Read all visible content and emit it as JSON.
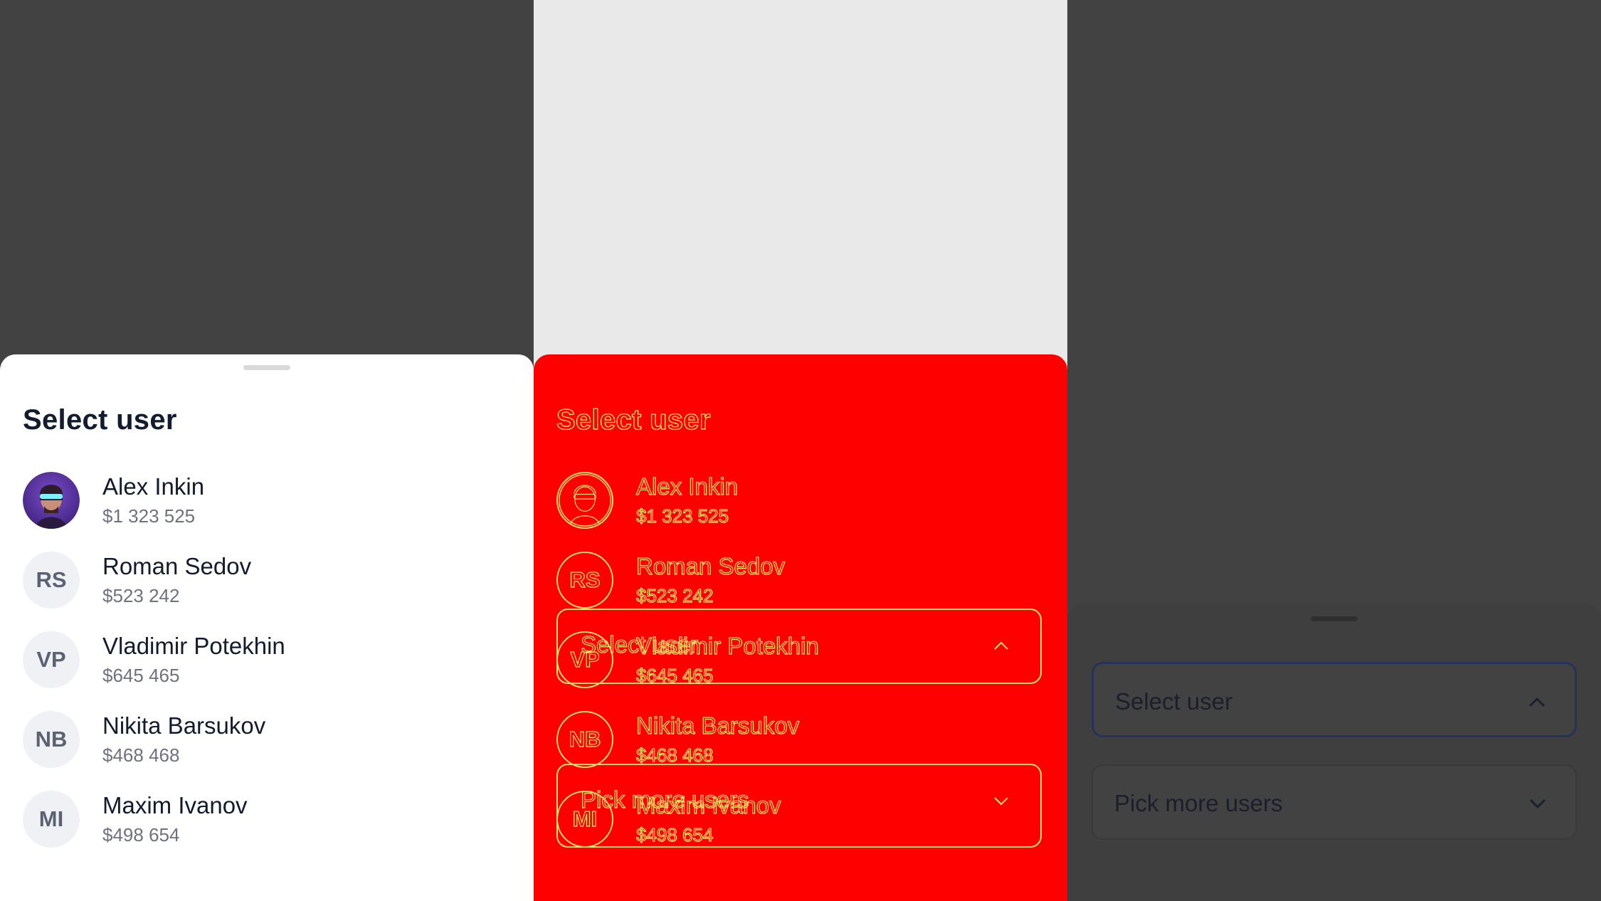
{
  "sheet": {
    "title": "Select user",
    "users": [
      {
        "name": "Alex Inkin",
        "amount": "$1 323 525",
        "initials": "",
        "has_photo": true
      },
      {
        "name": "Roman Sedov",
        "amount": "$523 242",
        "initials": "RS",
        "has_photo": false
      },
      {
        "name": "Vladimir Potekhin",
        "amount": "$645 465",
        "initials": "VP",
        "has_photo": false
      },
      {
        "name": "Nikita Barsukov",
        "amount": "$468 468",
        "initials": "NB",
        "has_photo": false
      },
      {
        "name": "Maxim Ivanov",
        "amount": "$498 654",
        "initials": "MI",
        "has_photo": false
      }
    ]
  },
  "form": {
    "select_label": "Select user",
    "multi_label": "Pick more users",
    "select_icon": "chevron-up-icon",
    "multi_icon": "chevron-down-icon"
  },
  "colors": {
    "backdrop": "#424242",
    "diff_background": "#ff0000",
    "diff_outline": "#ffe36b",
    "focus_border": "#263259",
    "text_primary": "#131b2e",
    "text_secondary": "#6d7181"
  }
}
